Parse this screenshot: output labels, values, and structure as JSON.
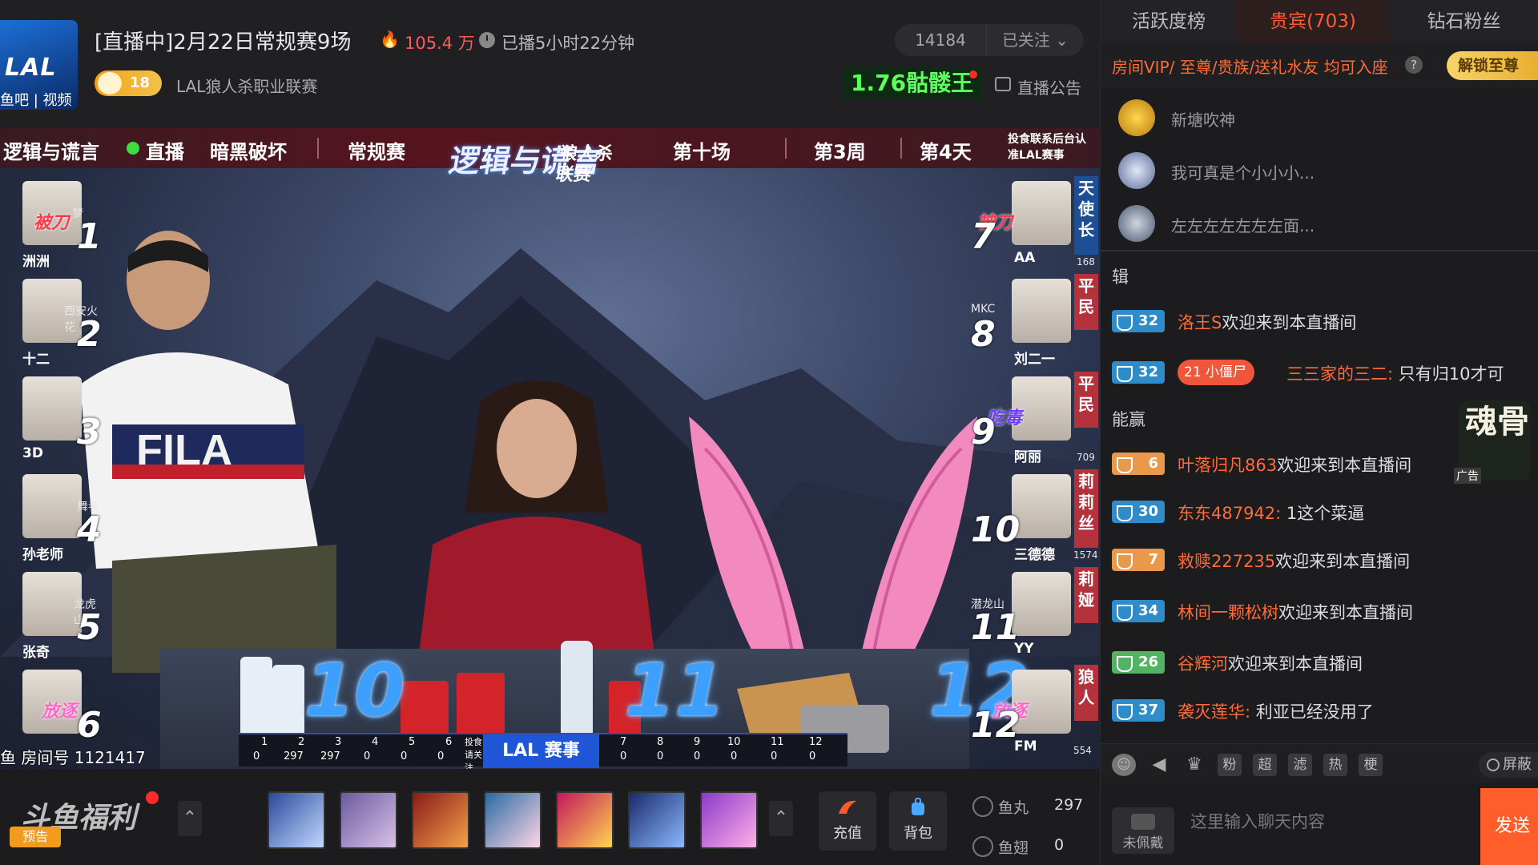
{
  "header": {
    "logo_text": "LAL",
    "logo_sub": "鱼吧 | 视频",
    "title": "[直播中]2月22日常规赛9场",
    "heat": "105.4 万",
    "duration": "已播5小时22分钟",
    "fans_count": "14184",
    "follow_label": "已关注",
    "level": "18",
    "channel_name": "LAL狼人杀职业联赛",
    "rank_title": "1.76骷髅王",
    "announce_label": "直播公告"
  },
  "video": {
    "banner": {
      "show": "逻辑与谎言",
      "live": "直播",
      "mode": "暗黑破坏",
      "stage": "常规赛",
      "event_logo_a": "逻辑与谎言",
      "event_logo_b": "狼人杀联赛",
      "match": "第十场",
      "week": "第3周",
      "day": "第4天",
      "contact": "投食联系后台认准LAL赛事"
    },
    "left_players": [
      {
        "num": "1",
        "name": "洲洲",
        "tag": "梦",
        "mark": "被刀"
      },
      {
        "num": "2",
        "name": "十二",
        "tag": "西安火花"
      },
      {
        "num": "3",
        "name": "3D",
        "tag": ""
      },
      {
        "num": "4",
        "name": "孙老师",
        "tag": "舞者"
      },
      {
        "num": "5",
        "name": "张奇",
        "tag": "龙虎山"
      },
      {
        "num": "6",
        "name": "",
        "tag": "",
        "mark": "放逐"
      }
    ],
    "right_players": [
      {
        "num": "7",
        "name": "AA",
        "role": "天使长",
        "score": "168",
        "mark": "被刀"
      },
      {
        "num": "8",
        "name": "刘二一",
        "role": "平民",
        "tag": "MKC"
      },
      {
        "num": "9",
        "name": "阿丽",
        "role": "平民",
        "score": "709",
        "mark": "吃毒"
      },
      {
        "num": "10",
        "name": "三德德",
        "role": "莉莉丝",
        "score": "1574"
      },
      {
        "num": "11",
        "name": "YY",
        "role": "莉娅",
        "tag": "潜龙山"
      },
      {
        "num": "12",
        "name": "FM",
        "role": "狼人",
        "score": "554",
        "mark": "放逐"
      }
    ],
    "seat_numbers": [
      "10",
      "11",
      "12"
    ],
    "score_left": [
      "1",
      "2",
      "3",
      "4",
      "5",
      "6"
    ],
    "score_left_values": [
      "0",
      "297",
      "297",
      "0",
      "0",
      "0"
    ],
    "score_right": [
      "7",
      "8",
      "9",
      "10",
      "11",
      "12"
    ],
    "score_right_values": [
      "0",
      "0",
      "0",
      "0",
      "0",
      "0"
    ],
    "lal_event": "LAL 赛事",
    "feed_label": "投食请关注",
    "room_id": "鱼 房间号 1121417"
  },
  "giftbar": {
    "promo_text": "斗鱼福利",
    "promo_pre": "预告",
    "recharge_label": "充值",
    "backpack_label": "背包",
    "fishball_label": "鱼丸",
    "fishball_value": "297",
    "fishwing_label": "鱼翅",
    "fishwing_value": "0"
  },
  "sidebar": {
    "tabs": [
      "活跃度榜",
      "贵宾(703)",
      "钻石粉丝"
    ],
    "vip_text": "房间VIP/ 至尊/贵族/送礼水友 均可入座",
    "unlock_label": "解锁至尊",
    "vip_users": [
      {
        "name": "新塘吹神",
        "badge": "黄金"
      },
      {
        "name": "我可真是个小小小...",
        "badge": "白银"
      },
      {
        "name": "左左左左左左左面...",
        "badge": "侠"
      }
    ],
    "sys_msgs": [
      "辑",
      "能赢"
    ],
    "messages": [
      {
        "level": "32",
        "color": "blue",
        "nick": "洛王S",
        "text": "欢迎来到本直播间"
      },
      {
        "level": "32",
        "color": "blue",
        "badge": "21 小僵尸",
        "nick": "三三家的三二:",
        "text": " 只有归10才可"
      },
      {
        "level": "6",
        "color": "orange",
        "nick": "叶落归凡863",
        "text": "欢迎来到本直播间"
      },
      {
        "level": "30",
        "color": "blue",
        "nick": "东东487942:",
        "text": " 1这个菜逼"
      },
      {
        "level": "7",
        "color": "orange",
        "nick": "救赎227235",
        "text": "欢迎来到本直播间"
      },
      {
        "level": "34",
        "color": "blue",
        "nick": "林间一颗松树",
        "text": "欢迎来到本直播间"
      },
      {
        "level": "26",
        "color": "green",
        "nick": "谷辉河",
        "text": "欢迎来到本直播间"
      },
      {
        "level": "37",
        "color": "blue",
        "nick": "袭灭莲华:",
        "text": " 利亚已经没用了"
      }
    ],
    "sticker_text": "魂骨",
    "sticker_ad": "广告",
    "tools": [
      "粉",
      "超",
      "滤",
      "热",
      "梗"
    ],
    "block_label": "屏蔽",
    "fans_badge_label": "未佩戴",
    "chat_placeholder": "这里输入聊天内容",
    "send_label": "发送"
  },
  "colors": {
    "accent": "#ff5d2a",
    "vip_orange": "#ff6b35",
    "rank_green": "#5dff5d",
    "level_blue": "#2d8cc9",
    "level_orange": "#e89a4a",
    "level_green": "#52b463"
  }
}
